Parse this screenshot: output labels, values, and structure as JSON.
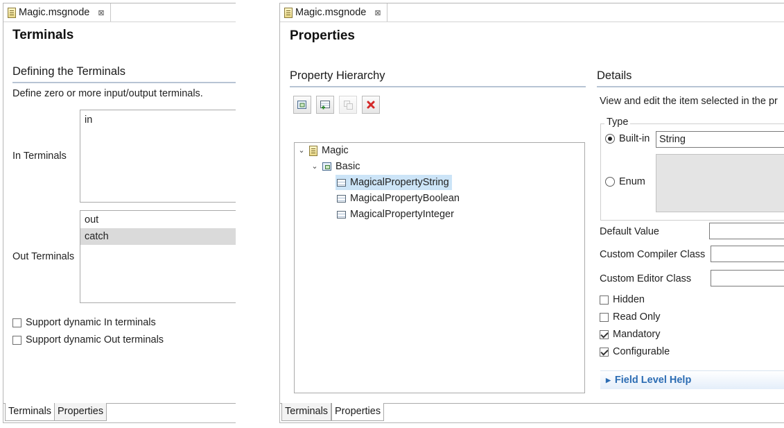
{
  "left_editor": {
    "file_tab": "Magic.msgnode",
    "page_title": "Terminals",
    "section_title": "Defining the Terminals",
    "description": "Define zero or more input/output terminals.",
    "in_terminals_label": "In Terminals",
    "in_terminals": [
      "in"
    ],
    "out_terminals_label": "Out Terminals",
    "out_terminals": [
      "out",
      "catch"
    ],
    "selected_out_terminal": "catch",
    "checkboxes": [
      {
        "label": "Support dynamic In terminals",
        "checked": false
      },
      {
        "label": "Support dynamic Out terminals",
        "checked": false
      }
    ],
    "bottom_tabs": [
      "Terminals",
      "Properties"
    ],
    "active_bottom_tab": "Terminals"
  },
  "right_editor": {
    "file_tab": "Magic.msgnode",
    "page_title": "Properties",
    "hierarchy_title": "Property Hierarchy",
    "toolbar": [
      {
        "icon": "add-category-icon",
        "enabled": true
      },
      {
        "icon": "add-property-icon",
        "enabled": true
      },
      {
        "icon": "copy-icon",
        "enabled": false
      },
      {
        "icon": "delete-icon",
        "enabled": true
      }
    ],
    "tree": {
      "root": "Magic",
      "group": "Basic",
      "properties": [
        "MagicalPropertyString",
        "MagicalPropertyBoolean",
        "MagicalPropertyInteger"
      ],
      "selected": "MagicalPropertyString"
    },
    "details_title": "Details",
    "details_description": "View and edit the item selected in the pr",
    "type_group": "Type",
    "type_options": [
      {
        "label": "Built-in",
        "checked": true,
        "value": "String"
      },
      {
        "label": "Enum",
        "checked": false
      }
    ],
    "fields": [
      {
        "label": "Default Value",
        "value": ""
      },
      {
        "label": "Custom Compiler Class",
        "value": ""
      },
      {
        "label": "Custom Editor Class",
        "value": ""
      }
    ],
    "flags": [
      {
        "label": "Hidden",
        "checked": false
      },
      {
        "label": "Read Only",
        "checked": false
      },
      {
        "label": "Mandatory",
        "checked": true
      },
      {
        "label": "Configurable",
        "checked": true
      }
    ],
    "field_level_help": "Field Level Help",
    "bottom_tabs": [
      "Terminals",
      "Properties"
    ],
    "active_bottom_tab": "Properties"
  }
}
